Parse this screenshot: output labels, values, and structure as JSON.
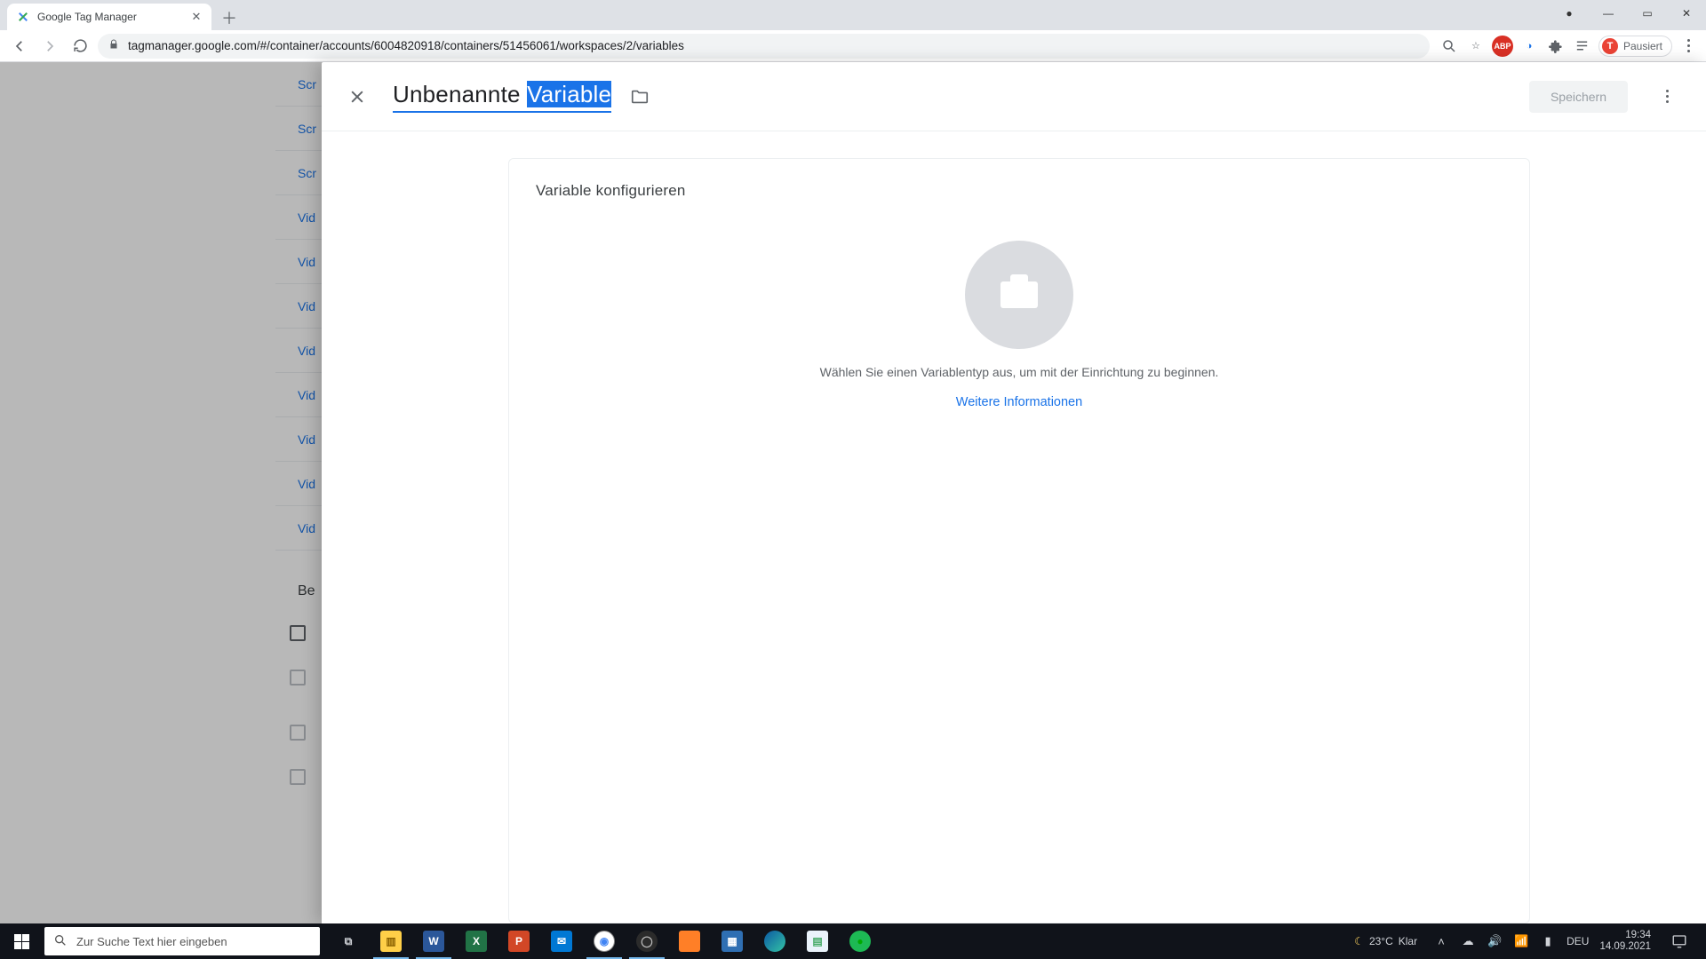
{
  "browser": {
    "tab_title": "Google Tag Manager",
    "url": "tagmanager.google.com/#/container/accounts/6004820918/containers/51456061/workspaces/2/variables",
    "avatar_letter": "T",
    "avatar_status": "Pausiert"
  },
  "bg": {
    "rows": [
      "Scr",
      "Scr",
      "Scr",
      "Vid",
      "Vid",
      "Vid",
      "Vid",
      "Vid",
      "Vid",
      "Vid",
      "Vid"
    ],
    "section_head": "Be"
  },
  "panel": {
    "title_prefix": "Unbenannte ",
    "title_selected": "Variable",
    "save_label": "Speichern",
    "card_title": "Variable konfigurieren",
    "hint": "Wählen Sie einen Variablentyp aus, um mit der Einrichtung zu beginnen.",
    "link": "Weitere Informationen"
  },
  "taskbar": {
    "search_placeholder": "Zur Suche Text hier eingeben",
    "weather_temp": "23°C",
    "weather_desc": "Klar",
    "lang": "DEU",
    "time": "19:34",
    "date": "14.09.2021"
  },
  "colors": {
    "accent": "#1a73e8"
  }
}
